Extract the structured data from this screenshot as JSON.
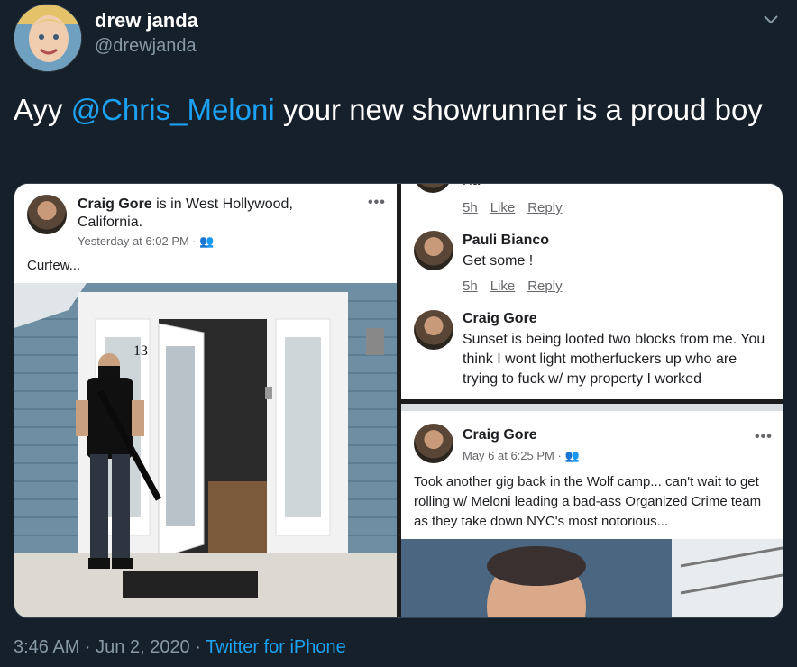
{
  "user": {
    "display_name": "drew janda",
    "handle": "@drewjanda"
  },
  "tweet": {
    "prefix": "Ayy ",
    "mention": "@Chris_Meloni",
    "suffix": " your new showrunner is a proud boy"
  },
  "post_left": {
    "author": "Craig Gore",
    "location_text": " is in West Hollywood, California.",
    "time": "Yesterday at 6:02 PM · ",
    "text": "Curfew..."
  },
  "comments": {
    "top_partial_text": "Ha",
    "actions_1": {
      "time": "5h",
      "like": "Like",
      "reply": "Reply"
    },
    "c1": {
      "author": "Pauli Bianco",
      "text": "Get some !"
    },
    "actions_2": {
      "time": "5h",
      "like": "Like",
      "reply": "Reply"
    },
    "c2": {
      "author": "Craig Gore",
      "text": "Sunset is being looted two blocks from me. You think I wont light motherfuckers up who are trying to fuck w/ my property I worked"
    }
  },
  "post_right": {
    "author": "Craig Gore",
    "time": "May 6 at 6:25 PM · ",
    "text": "Took another gig back in the Wolf camp... can't wait to get rolling w/ Meloni leading a bad-ass Organized Crime team as they take down NYC's most notorious..."
  },
  "footer": {
    "time": "3:46 AM · Jun 2, 2020 · ",
    "source": "Twitter for iPhone"
  },
  "icons": {
    "caret": "chevron-down-icon",
    "more": "more-dots-icon",
    "audience": "friends-icon"
  }
}
